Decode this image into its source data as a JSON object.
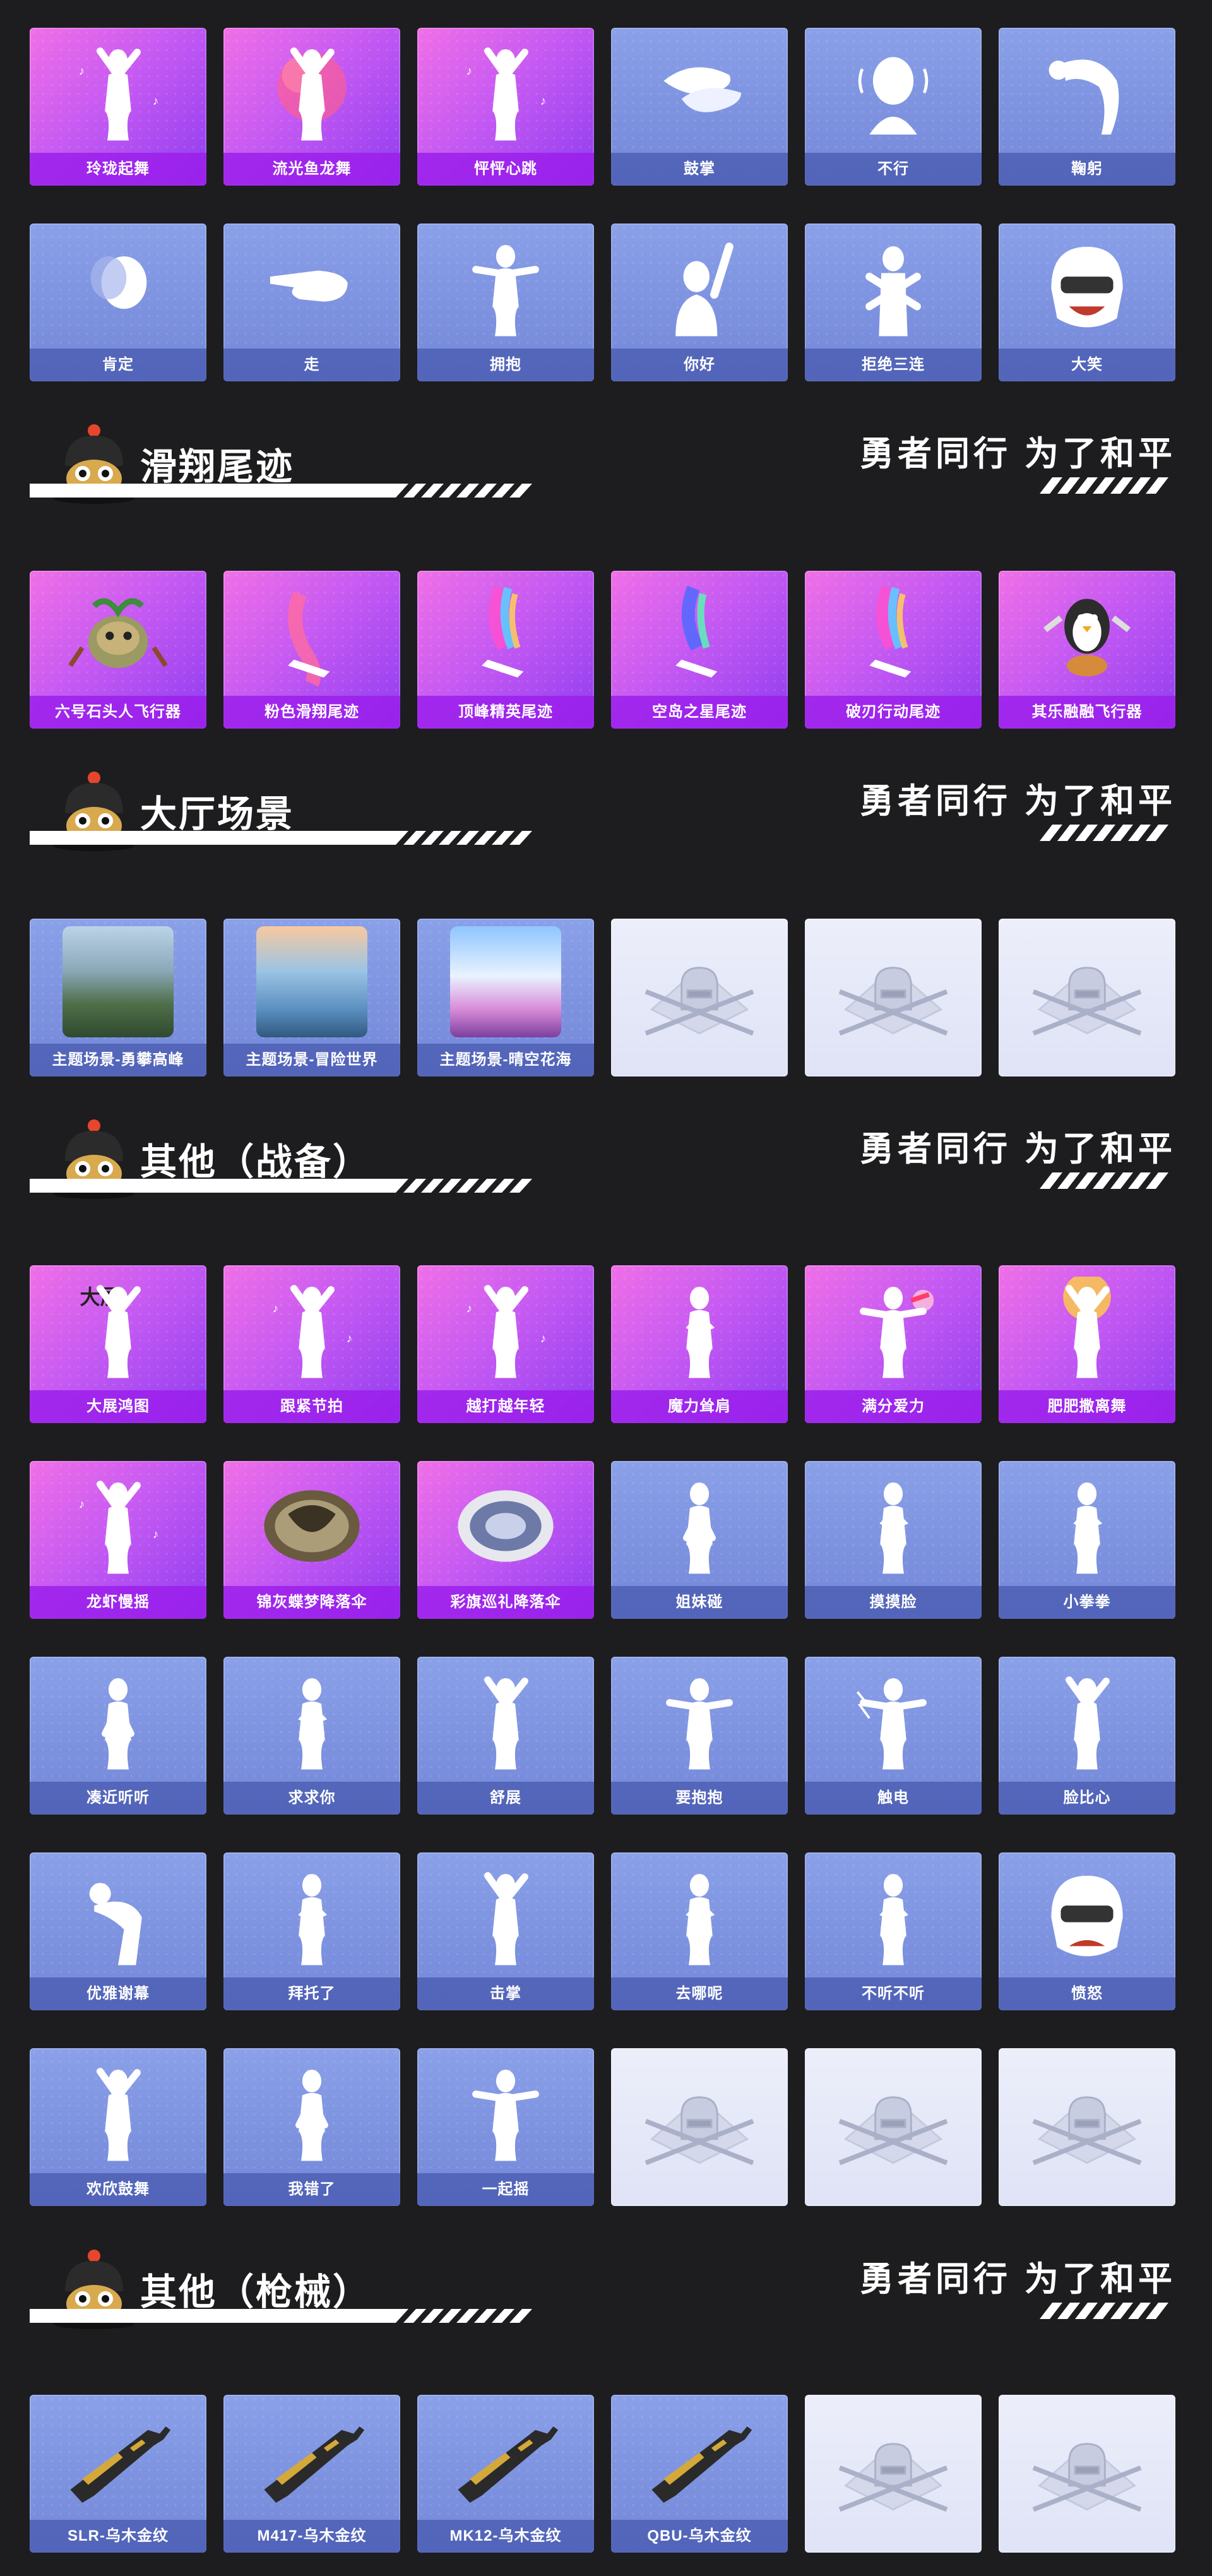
{
  "slogan": "勇者同行 为了和平",
  "emotes_top": {
    "row1": [
      {
        "label": "玲珑起舞",
        "style": "purple",
        "icon": "dancer-icon"
      },
      {
        "label": "流光鱼龙舞",
        "style": "purple",
        "icon": "dragon-dancer-icon"
      },
      {
        "label": "怦怦心跳",
        "style": "purple",
        "icon": "dancer-icon"
      },
      {
        "label": "鼓掌",
        "style": "blue",
        "icon": "clapping-hands-icon"
      },
      {
        "label": "不行",
        "style": "blue",
        "icon": "head-shake-icon"
      },
      {
        "label": "鞠躬",
        "style": "blue",
        "icon": "bow-icon"
      }
    ],
    "row2": [
      {
        "label": "肯定",
        "style": "blue",
        "icon": "nod-icon"
      },
      {
        "label": "走",
        "style": "blue",
        "icon": "pointing-hand-icon"
      },
      {
        "label": "拥抱",
        "style": "blue",
        "icon": "hug-icon"
      },
      {
        "label": "你好",
        "style": "blue",
        "icon": "wave-icon"
      },
      {
        "label": "拒绝三连",
        "style": "blue",
        "icon": "crossed-arms-icon"
      },
      {
        "label": "大笑",
        "style": "blue",
        "icon": "laughing-helmet-icon"
      }
    ]
  },
  "sections": {
    "glide_trails": {
      "title": "滑翔尾迹",
      "items": [
        {
          "label": "六号石头人飞行器",
          "style": "purple",
          "icon": "stone-creature-icon"
        },
        {
          "label": "粉色滑翔尾迹",
          "style": "purple",
          "icon": "pink-trail-icon"
        },
        {
          "label": "顶峰精英尾迹",
          "style": "purple",
          "icon": "rainbow-trail-icon"
        },
        {
          "label": "空岛之星尾迹",
          "style": "purple",
          "icon": "star-trail-icon"
        },
        {
          "label": "破刃行动尾迹",
          "style": "purple",
          "icon": "rainbow-trail-icon"
        },
        {
          "label": "其乐融融飞行器",
          "style": "purple",
          "icon": "penguin-glider-icon"
        }
      ]
    },
    "lobby_scenes": {
      "title": "大厅场景",
      "items": [
        {
          "label": "主题场景-勇攀高峰",
          "style": "blue",
          "icon": "mountain-scene-icon"
        },
        {
          "label": "主题场景-冒险世界",
          "style": "blue",
          "icon": "sea-scene-icon"
        },
        {
          "label": "主题场景-晴空花海",
          "style": "blue",
          "icon": "flower-sky-scene-icon"
        },
        {
          "label": "",
          "style": "gray",
          "icon": "pubg-emblem-icon"
        },
        {
          "label": "",
          "style": "gray",
          "icon": "pubg-emblem-icon"
        },
        {
          "label": "",
          "style": "gray",
          "icon": "pubg-emblem-icon"
        }
      ]
    },
    "other_gear": {
      "title": "其他（战备）",
      "rows": [
        [
          {
            "label": "大展鸿图",
            "style": "purple",
            "icon": "banner-dancer-icon"
          },
          {
            "label": "跟紧节拍",
            "style": "purple",
            "icon": "dancer-icon"
          },
          {
            "label": "越打越年轻",
            "style": "purple",
            "icon": "dancer-icon"
          },
          {
            "label": "魔力耸肩",
            "style": "purple",
            "icon": "shrug-icon"
          },
          {
            "label": "满分爱力",
            "style": "purple",
            "icon": "heart-blast-icon"
          },
          {
            "label": "肥肥撒离舞",
            "style": "purple",
            "icon": "confetti-dancer-icon"
          }
        ],
        [
          {
            "label": "龙虾慢摇",
            "style": "purple",
            "icon": "dancer-icon"
          },
          {
            "label": "锦灰蝶梦降落伞",
            "style": "purple",
            "icon": "butterfly-parachute-icon"
          },
          {
            "label": "彩旗巡礼降落伞",
            "style": "purple",
            "icon": "flag-parachute-icon"
          },
          {
            "label": "姐妹碰",
            "style": "blue",
            "icon": "hip-bump-icon"
          },
          {
            "label": "摸摸脸",
            "style": "blue",
            "icon": "face-touch-icon"
          },
          {
            "label": "小拳拳",
            "style": "blue",
            "icon": "fist-icon"
          }
        ],
        [
          {
            "label": "凑近听听",
            "style": "blue",
            "icon": "listen-icon"
          },
          {
            "label": "求求你",
            "style": "blue",
            "icon": "plead-icon"
          },
          {
            "label": "舒展",
            "style": "blue",
            "icon": "stretch-icon"
          },
          {
            "label": "要抱抱",
            "style": "blue",
            "icon": "open-arms-icon"
          },
          {
            "label": "触电",
            "style": "blue",
            "icon": "electric-shock-icon"
          },
          {
            "label": "脸比心",
            "style": "blue",
            "icon": "heart-face-icon"
          }
        ],
        [
          {
            "label": "优雅谢幕",
            "style": "blue",
            "icon": "curtain-bow-icon"
          },
          {
            "label": "拜托了",
            "style": "blue",
            "icon": "please-icon"
          },
          {
            "label": "击掌",
            "style": "blue",
            "icon": "high-five-icon"
          },
          {
            "label": "去哪呢",
            "style": "blue",
            "icon": "shrug-icon"
          },
          {
            "label": "不听不听",
            "style": "blue",
            "icon": "ears-covered-icon"
          },
          {
            "label": "愤怒",
            "style": "blue",
            "icon": "angry-helmet-icon"
          }
        ],
        [
          {
            "label": "欢欣鼓舞",
            "style": "blue",
            "icon": "cheer-icon"
          },
          {
            "label": "我错了",
            "style": "blue",
            "icon": "sorry-icon"
          },
          {
            "label": "一起摇",
            "style": "blue",
            "icon": "sway-icon"
          },
          {
            "label": "",
            "style": "gray",
            "icon": "pubg-emblem-icon"
          },
          {
            "label": "",
            "style": "gray",
            "icon": "pubg-emblem-icon"
          },
          {
            "label": "",
            "style": "gray",
            "icon": "pubg-emblem-icon"
          }
        ]
      ]
    },
    "other_weapons": {
      "title": "其他（枪械）",
      "items": [
        {
          "label": "SLR-乌木金纹",
          "style": "blue",
          "icon": "rifle-icon"
        },
        {
          "label": "M417-乌木金纹",
          "style": "blue",
          "icon": "rifle-icon"
        },
        {
          "label": "MK12-乌木金纹",
          "style": "blue",
          "icon": "rifle-icon"
        },
        {
          "label": "QBU-乌木金纹",
          "style": "blue",
          "icon": "rifle-icon"
        },
        {
          "label": "",
          "style": "gray",
          "icon": "pubg-emblem-icon"
        },
        {
          "label": "",
          "style": "gray",
          "icon": "pubg-emblem-icon"
        }
      ]
    }
  },
  "colors": {
    "background": "#1d1d1f",
    "purple_card": "#c65af2",
    "blue_card": "#7b8fe0",
    "gray_card": "#e4e7f8"
  }
}
